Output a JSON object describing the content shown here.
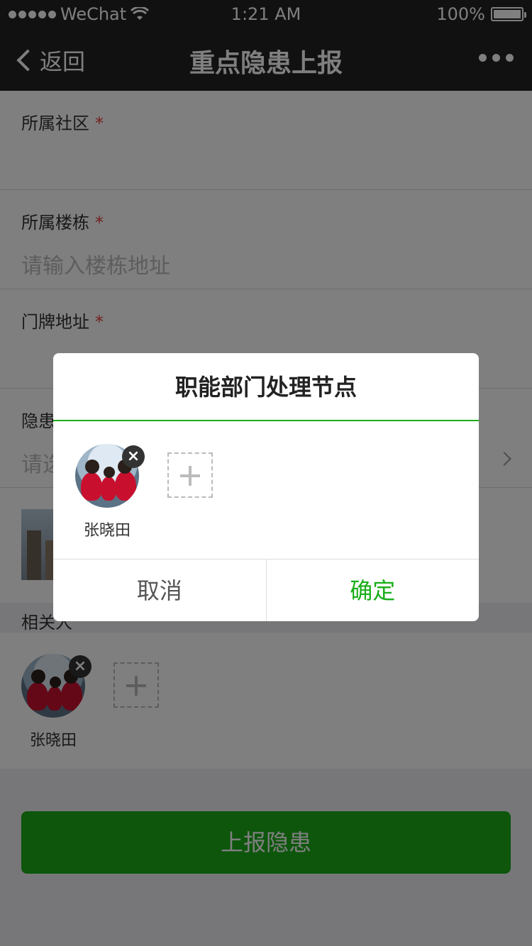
{
  "status_bar": {
    "carrier": "WeChat",
    "time": "1:21 AM",
    "battery": "100%"
  },
  "nav": {
    "back_label": "返回",
    "title": "重点隐患上报"
  },
  "form": {
    "community_label": "所属社区",
    "building_label": "所属楼栋",
    "building_placeholder": "请输入楼栋地址",
    "door_label": "门牌地址",
    "hazard_label": "隐患",
    "hazard_placeholder": "请选"
  },
  "related": {
    "label": "相关人",
    "person_name": "张晓田"
  },
  "submit_label": "上报隐患",
  "dialog": {
    "title": "职能部门处理节点",
    "person_name": "张晓田",
    "cancel_label": "取消",
    "confirm_label": "确定"
  },
  "colors": {
    "accent": "#1aad19",
    "required": "#e64340",
    "nav_bg": "#222225"
  }
}
